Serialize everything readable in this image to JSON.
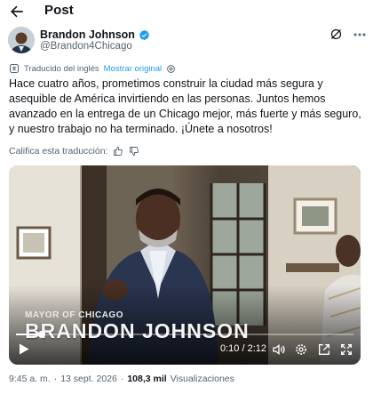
{
  "header": {
    "title": "Post"
  },
  "author": {
    "name": "Brandon Johnson",
    "handle": "@Brandon4Chicago"
  },
  "translation": {
    "notice": "Traducido del inglés",
    "show_original": "Mostrar original",
    "rate_label": "Califica esta traducción:"
  },
  "post": {
    "text": "Hace cuatro años, prometimos construir la ciudad más segura y asequible de América invirtiendo en las personas. Juntos hemos avanzado en la entrega de un Chicago mejor, más fuerte y más seguro, y nuestro trabajo no ha terminado. ¡Únete a nosotros!"
  },
  "video": {
    "overlay_subtitle": "MAYOR OF CHICAGO",
    "overlay_name": "BRANDON JOHNSON",
    "time": "0:10 / 2:12",
    "progress": 0.076,
    "controls": [
      "play-icon",
      "volume-icon",
      "settings-icon",
      "open-external-icon",
      "fullscreen-icon"
    ]
  },
  "meta": {
    "time": "9:45 a. m.",
    "separator": "·",
    "date": "13 sept. 2026",
    "separator2": "·",
    "views_count": "108,3 mil",
    "views_label": "Visualizaciones"
  },
  "colors": {
    "accent": "#1d9bf0",
    "text": "#0f1419",
    "secondary": "#536471"
  }
}
